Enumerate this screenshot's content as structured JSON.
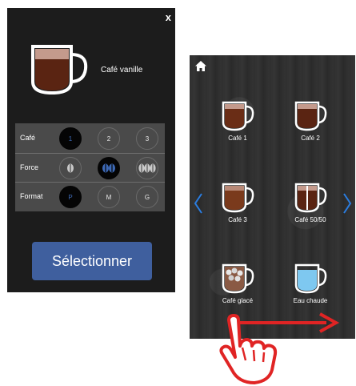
{
  "left_panel": {
    "close_label": "x",
    "selected_drink": "Café vanille",
    "rows": [
      {
        "label": "Café",
        "options": [
          "1",
          "2",
          "3"
        ],
        "selected_index": 0
      },
      {
        "label": "Force",
        "options": [
          "force-low-icon",
          "force-medium-icon",
          "force-high-icon"
        ],
        "selected_index": 1
      },
      {
        "label": "Format",
        "options": [
          "P",
          "M",
          "G"
        ],
        "selected_index": 0
      }
    ],
    "select_button": "Sélectionner"
  },
  "right_panel": {
    "drinks": [
      {
        "label": "Café 1"
      },
      {
        "label": "Café 2"
      },
      {
        "label": "Café 3"
      },
      {
        "label": "Café 50/50"
      },
      {
        "label": "Café glacé"
      },
      {
        "label": "Eau chaude"
      }
    ],
    "icons": [
      "home-icon",
      "chevron-left-icon",
      "chevron-right-icon",
      "swipe-arrow-icon",
      "hand-pointer-icon"
    ]
  },
  "colors": {
    "panel_bg": "#1c1c1c",
    "button_blue": "#3f5f9e",
    "nav_arrow_blue": "#2a7de1",
    "swipe_red": "#e02424",
    "cup_coffee": "#5a2412",
    "cup_milk": "#c49a8c",
    "water_blue": "#7ec8f0"
  }
}
